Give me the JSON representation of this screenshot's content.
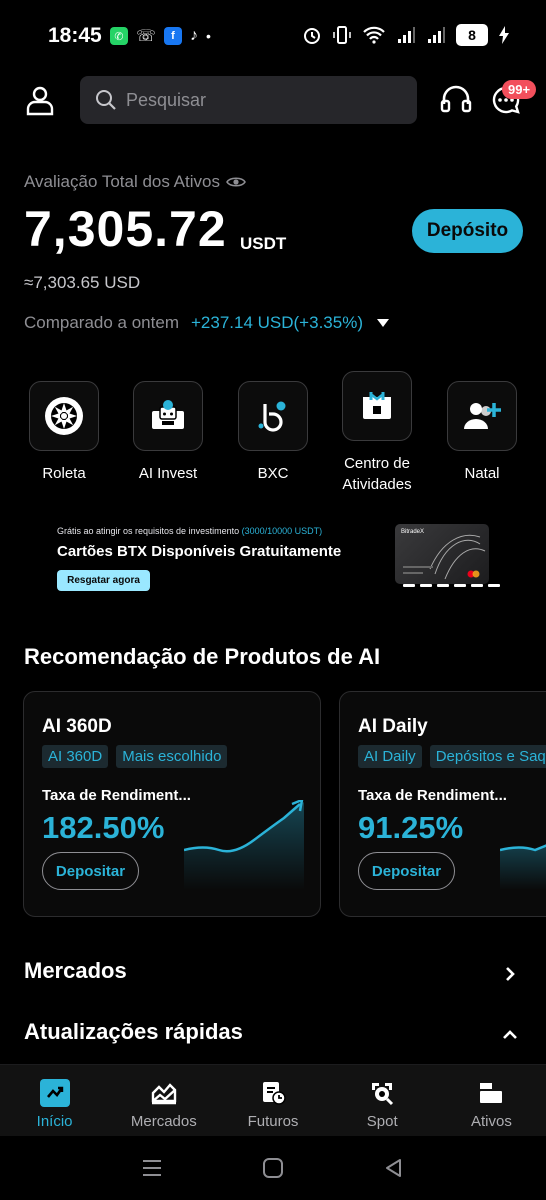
{
  "status_bar": {
    "time": "18:45",
    "battery_level": "8",
    "icons": [
      "whatsapp-icon",
      "missed-call-icon",
      "facebook-icon",
      "tiktok-icon",
      "dot-icon",
      "alarm-icon",
      "vibrate-icon",
      "wifi-icon",
      "signal-icon",
      "signal-icon",
      "battery-icon",
      "charging-icon"
    ]
  },
  "header": {
    "search_placeholder": "Pesquisar",
    "notification_badge": "99+"
  },
  "assets": {
    "label": "Avaliação Total dos Ativos",
    "amount": "7,305.72",
    "unit": "USDT",
    "usd_equivalent": "≈7,303.65 USD",
    "deposit_button": "Depósito",
    "compare_label": "Comparado a ontem",
    "compare_value": "+237.14 USD(+3.35%)"
  },
  "shortcuts": [
    {
      "label": "Roleta",
      "icon": "roulette-icon"
    },
    {
      "label": "AI Invest",
      "icon": "ai-bot-icon"
    },
    {
      "label": "BXC",
      "icon": "bxc-logo-icon"
    },
    {
      "label": "Centro de Atividades",
      "icon": "gift-calendar-icon"
    },
    {
      "label": "Natal",
      "icon": "add-user-icon"
    }
  ],
  "banner": {
    "subtitle_prefix": "Grátis ao atingir os requisitos de investimento",
    "subtitle_highlight": "(3000/10000 USDT)",
    "title": "Cartões BTX Disponíveis Gratuitamente",
    "button": "Resgatar agora",
    "card_brand": "BitradeX"
  },
  "ai_section": {
    "title": "Recomendação de Produtos de AI",
    "products": [
      {
        "name": "AI 360D",
        "tags": [
          "AI 360D",
          "Mais escolhido"
        ],
        "rate_label": "Taxa de Rendiment...",
        "rate": "182.50%",
        "button": "Depositar"
      },
      {
        "name": "AI Daily",
        "tags": [
          "AI Daily",
          "Depósitos e Saqu"
        ],
        "rate_label": "Taxa de Rendiment...",
        "rate": "91.25%",
        "button": "Depositar"
      }
    ]
  },
  "markets_row": {
    "label": "Mercados"
  },
  "updates_row": {
    "label": "Atualizações rápidas"
  },
  "tab_bar": [
    {
      "label": "Início",
      "icon": "home-icon",
      "active": true
    },
    {
      "label": "Mercados",
      "icon": "markets-icon",
      "active": false
    },
    {
      "label": "Futuros",
      "icon": "futures-icon",
      "active": false
    },
    {
      "label": "Spot",
      "icon": "spot-icon",
      "active": false
    },
    {
      "label": "Ativos",
      "icon": "wallet-icon",
      "active": false
    }
  ],
  "colors": {
    "accent": "#2bb3d8",
    "background": "#000000",
    "badge": "#f24f5c"
  }
}
